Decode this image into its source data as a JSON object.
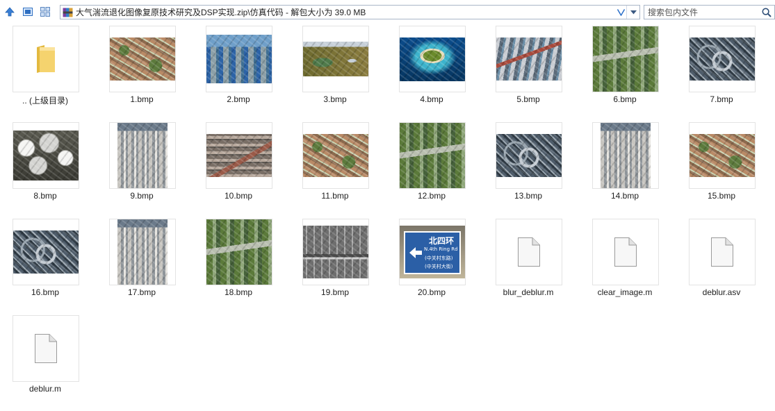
{
  "toolbar": {
    "path": "大气湍流退化图像复原技术研究及DSP实现.zip\\仿真代码 - 解包大小为 39.0 MB",
    "search_placeholder": "搜索包内文件"
  },
  "items": [
    {
      "label": ".. (上级目录)",
      "kind": "folder"
    },
    {
      "label": "1.bmp",
      "kind": "image",
      "scene": "village",
      "colors": [
        "#8b6a4e",
        "#5c7a3c",
        "#b98a66",
        "#c9d2b0"
      ]
    },
    {
      "label": "2.bmp",
      "kind": "image",
      "scene": "city-blue",
      "colors": [
        "#6f9fc9",
        "#3f6f94",
        "#8ca0a8",
        "#2c63a6"
      ]
    },
    {
      "label": "3.bmp",
      "kind": "image",
      "scene": "wetland",
      "colors": [
        "#6d6a2e",
        "#4f7a4a",
        "#c7d0d9",
        "#8a7c3f"
      ]
    },
    {
      "label": "4.bmp",
      "kind": "image",
      "scene": "island",
      "colors": [
        "#0a4c8c",
        "#3cb3cc",
        "#6a8a2a",
        "#e9dfbd"
      ]
    },
    {
      "label": "5.bmp",
      "kind": "image",
      "scene": "port",
      "colors": [
        "#5c6b7a",
        "#a94a3c",
        "#c8ccd2",
        "#6a8ea8"
      ]
    },
    {
      "label": "6.bmp",
      "kind": "image",
      "scene": "airport",
      "colors": [
        "#5b7a3a",
        "#8fa77a",
        "#b9bfb0",
        "#46623a"
      ]
    },
    {
      "label": "7.bmp",
      "kind": "image",
      "scene": "interchange",
      "colors": [
        "#4f5d6b",
        "#9aa6b0",
        "#2f3a44",
        "#c6cdd4"
      ]
    },
    {
      "label": "8.bmp",
      "kind": "image",
      "scene": "clouds",
      "colors": [
        "#d5d5d2",
        "#5a5a50",
        "#f5f5f3",
        "#3a3a33"
      ]
    },
    {
      "label": "9.bmp",
      "kind": "image",
      "scene": "towers",
      "colors": [
        "#8f959a",
        "#c7c5c0",
        "#4d5a3e",
        "#6b7a8a"
      ]
    },
    {
      "label": "10.bmp",
      "kind": "image",
      "scene": "port-gray",
      "colors": [
        "#7a6f66",
        "#b7a89c",
        "#9a5a48",
        "#5c5650"
      ]
    },
    {
      "label": "11.bmp",
      "kind": "image",
      "scene": "village",
      "colors": [
        "#8b6a4e",
        "#5c7a3c",
        "#b98a66",
        "#c9d2b0"
      ]
    },
    {
      "label": "12.bmp",
      "kind": "image",
      "scene": "airport",
      "colors": [
        "#5b7a3a",
        "#8fa77a",
        "#b9bfb0",
        "#46623a"
      ]
    },
    {
      "label": "13.bmp",
      "kind": "image",
      "scene": "interchange",
      "colors": [
        "#4f5d6b",
        "#9aa6b0",
        "#2f3a44",
        "#c6cdd4"
      ]
    },
    {
      "label": "14.bmp",
      "kind": "image",
      "scene": "towers",
      "colors": [
        "#8f959a",
        "#c7c5c0",
        "#4d5a3e",
        "#6b7a8a"
      ]
    },
    {
      "label": "15.bmp",
      "kind": "image",
      "scene": "village",
      "colors": [
        "#8b6a4e",
        "#5c7a3c",
        "#b98a66",
        "#c9d2b0"
      ]
    },
    {
      "label": "16.bmp",
      "kind": "image",
      "scene": "interchange",
      "colors": [
        "#4f5d6b",
        "#9aa6b0",
        "#2f3a44",
        "#c6cdd4"
      ]
    },
    {
      "label": "17.bmp",
      "kind": "image",
      "scene": "towers",
      "colors": [
        "#8f959a",
        "#c7c5c0",
        "#4d5a3e",
        "#6b7a8a"
      ]
    },
    {
      "label": "18.bmp",
      "kind": "image",
      "scene": "airport",
      "colors": [
        "#5b7a3a",
        "#8fa77a",
        "#b9bfb0",
        "#46623a"
      ]
    },
    {
      "label": "19.bmp",
      "kind": "image",
      "scene": "gray-bridge",
      "colors": [
        "#6e6e6e",
        "#a8a8a8",
        "#4a4a4a",
        "#d0d0d0"
      ]
    },
    {
      "label": "20.bmp",
      "kind": "image",
      "scene": "road-sign",
      "colors": [
        "#2b5fa6",
        "#7b7568",
        "#ffffff",
        "#c0b59a"
      ]
    },
    {
      "label": "blur_deblur.m",
      "kind": "file"
    },
    {
      "label": "clear_image.m",
      "kind": "file"
    },
    {
      "label": "deblur.asv",
      "kind": "file"
    },
    {
      "label": "deblur.m",
      "kind": "file"
    }
  ],
  "sign": {
    "line1": "北四环",
    "line2": "N.4th Ring Rd",
    "line3": "(中关村东路)",
    "line4": "(中关村大街)"
  }
}
